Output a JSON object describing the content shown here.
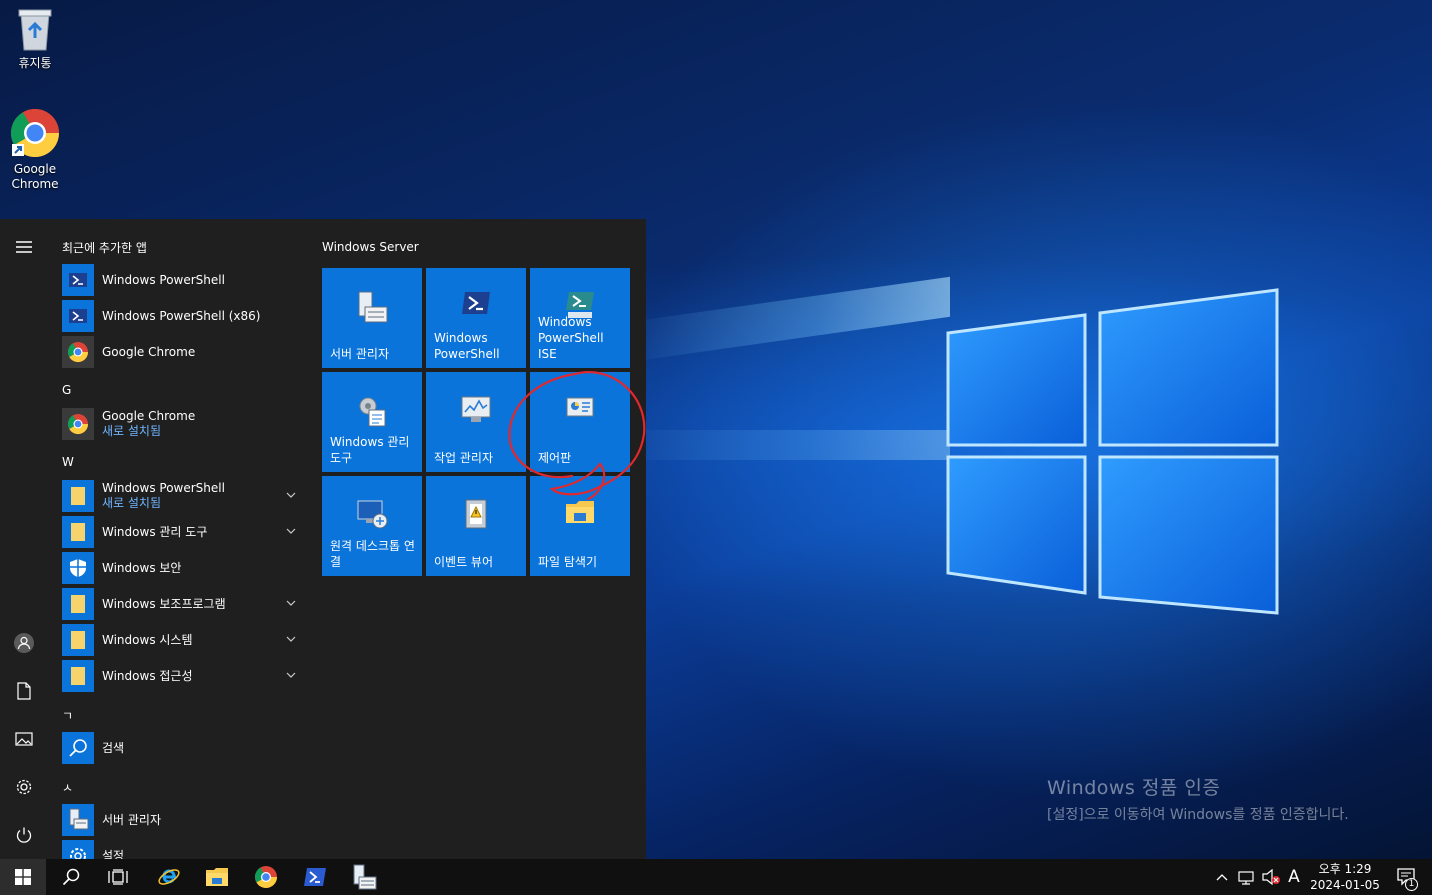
{
  "desktop": {
    "icons": [
      {
        "label": "휴지통"
      },
      {
        "label": "Google Chrome"
      }
    ],
    "activation": {
      "title": "Windows 정품 인증",
      "subtitle": "[설정]으로 이동하여 Windows를 정품 인증합니다."
    }
  },
  "start_menu": {
    "recent_header": "최근에 추가한 앱",
    "recent": [
      {
        "label": "Windows PowerShell"
      },
      {
        "label": "Windows PowerShell (x86)"
      },
      {
        "label": "Google Chrome"
      }
    ],
    "group_g": "G",
    "g_items": [
      {
        "label": "Google Chrome",
        "sub": "새로 설치됨"
      }
    ],
    "group_w": "W",
    "w_items": [
      {
        "label": "Windows PowerShell",
        "sub": "새로 설치됨"
      },
      {
        "label": "Windows 관리 도구"
      },
      {
        "label": "Windows 보안"
      },
      {
        "label": "Windows 보조프로그램"
      },
      {
        "label": "Windows 시스템"
      },
      {
        "label": "Windows 접근성"
      }
    ],
    "group_k": "ㄱ",
    "k_items": [
      {
        "label": "검색"
      }
    ],
    "group_s": "ㅅ",
    "s_items": [
      {
        "label": "서버 관리자"
      },
      {
        "label": "설정"
      }
    ],
    "tiles_title": "Windows Server",
    "tiles": [
      {
        "label": "서버 관리자",
        "icon": "server-manager-icon"
      },
      {
        "label": "Windows PowerShell",
        "icon": "powershell-icon"
      },
      {
        "label": "Windows PowerShell ISE",
        "icon": "powershell-ise-icon"
      },
      {
        "label": "Windows 관리 도구",
        "icon": "admin-tools-icon"
      },
      {
        "label": "작업 관리자",
        "icon": "task-manager-icon"
      },
      {
        "label": "제어판",
        "icon": "control-panel-icon"
      },
      {
        "label": "원격 데스크톱 연결",
        "icon": "remote-desktop-icon"
      },
      {
        "label": "이벤트 뷰어",
        "icon": "event-viewer-icon"
      },
      {
        "label": "파일 탐색기",
        "icon": "file-explorer-icon"
      }
    ],
    "annotation_color": "#e0282e"
  },
  "taskbar": {
    "ime": "A",
    "time": "오후 1:29",
    "date": "2024-01-05",
    "notification_count": "1"
  },
  "colors": {
    "tile": "#0a74da",
    "menu_bg": "#1f1f1f",
    "accent_text": "#6fb5ff"
  }
}
